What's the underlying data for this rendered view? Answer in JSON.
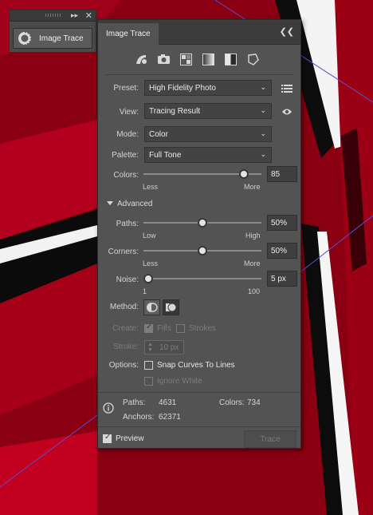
{
  "dock": {
    "tool_label": "Image Trace",
    "expand_icon": "double-chevron-right-icon",
    "close_icon": "close-icon"
  },
  "panel": {
    "tab_label": "Image Trace",
    "collapse_icon": "double-chevron-left-icon",
    "preset_icons": [
      "auto-color-icon",
      "high-color-icon",
      "low-color-icon",
      "grayscale-icon",
      "black-white-icon",
      "outline-icon"
    ],
    "preset": {
      "label": "Preset:",
      "value": "High Fidelity Photo",
      "menu_icon": "list-menu-icon"
    },
    "view": {
      "label": "View:",
      "value": "Tracing Result",
      "eye_icon": "eye-icon"
    },
    "mode": {
      "label": "Mode:",
      "value": "Color"
    },
    "palette": {
      "label": "Palette:",
      "value": "Full Tone"
    },
    "colors": {
      "label": "Colors:",
      "value": "85",
      "fraction": 0.85,
      "min_label": "Less",
      "max_label": "More"
    },
    "advanced_label": "Advanced",
    "paths": {
      "label": "Paths:",
      "value": "50%",
      "fraction": 0.5,
      "min_label": "Low",
      "max_label": "High"
    },
    "corners": {
      "label": "Corners:",
      "value": "50%",
      "fraction": 0.5,
      "min_label": "Less",
      "max_label": "More"
    },
    "noise": {
      "label": "Noise:",
      "value": "5 px",
      "fraction": 0.04,
      "min_label": "1",
      "max_label": "100"
    },
    "method": {
      "label": "Method:",
      "abutting_icon": "abutting-method-icon",
      "overlapping_icon": "overlapping-method-icon"
    },
    "create": {
      "label": "Create:",
      "fills_label": "Fills",
      "strokes_label": "Strokes"
    },
    "stroke": {
      "label": "Stroke:",
      "value": "10 px"
    },
    "options": {
      "label": "Options:",
      "snap_label": "Snap Curves To Lines",
      "ignore_white_label": "Ignore White"
    },
    "stats": {
      "paths_label": "Paths:",
      "paths_value": "4631",
      "colors_label": "Colors:",
      "colors_value": "734",
      "anchors_label": "Anchors:",
      "anchors_value": "62371"
    },
    "info_icon": "info-icon",
    "preview_label": "Preview",
    "trace_label": "Trace"
  },
  "colors": {
    "canvas_red": "#8c0010",
    "panel_bg": "#535353",
    "guide_line": "#5a4fcf"
  }
}
